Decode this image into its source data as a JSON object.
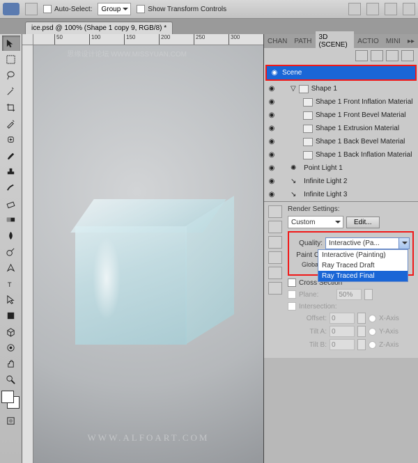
{
  "options_bar": {
    "auto_select_label": "Auto-Select:",
    "auto_select_value": "Group",
    "show_transform_label": "Show Transform Controls"
  },
  "document_tab": "ice.psd @ 100% (Shape 1 copy 9, RGB/8) *",
  "ruler_marks": [
    "50",
    "100",
    "150",
    "200",
    "250",
    "300"
  ],
  "watermark_top": "思缘设计论坛    WWW.MISSYUAN.COM",
  "watermark_center": "WWW.ALFOART.COM",
  "panel_tabs": {
    "chan": "CHAN",
    "path": "PATH",
    "scene3d": "3D (SCENE)",
    "actio": "ACTIO",
    "mini": "MINI"
  },
  "scene_tree": {
    "scene": "Scene",
    "shape1": "Shape 1",
    "materials": [
      "Shape 1 Front Inflation Material",
      "Shape 1 Front Bevel Material",
      "Shape 1 Extrusion Material",
      "Shape 1 Back Bevel Material",
      "Shape 1 Back Inflation Material"
    ],
    "lights": [
      "Point Light 1",
      "Infinite Light 2",
      "Infinite Light 3"
    ]
  },
  "render_settings": {
    "title": "Render Settings:",
    "preset_value": "Custom",
    "edit_label": "Edit...",
    "quality_label": "Quality:",
    "quality_value": "Interactive (Pa...",
    "quality_options": [
      "Interactive (Painting)",
      "Ray Traced Draft",
      "Ray Traced Final"
    ],
    "paint_on_label": "Paint On:",
    "global_amb_label": "Global A",
    "cross_section_label": "Cross Section",
    "plane_label": "Plane:",
    "plane_value": "50%",
    "intersection_label": "Intersection:",
    "offset_label": "Offset:",
    "offset_value": "0",
    "tilt_a_label": "Tilt A:",
    "tilt_a_value": "0",
    "tilt_b_label": "Tilt B:",
    "tilt_b_value": "0",
    "x_axis": "X-Axis",
    "y_axis": "Y-Axis",
    "z_axis": "Z-Axis"
  }
}
